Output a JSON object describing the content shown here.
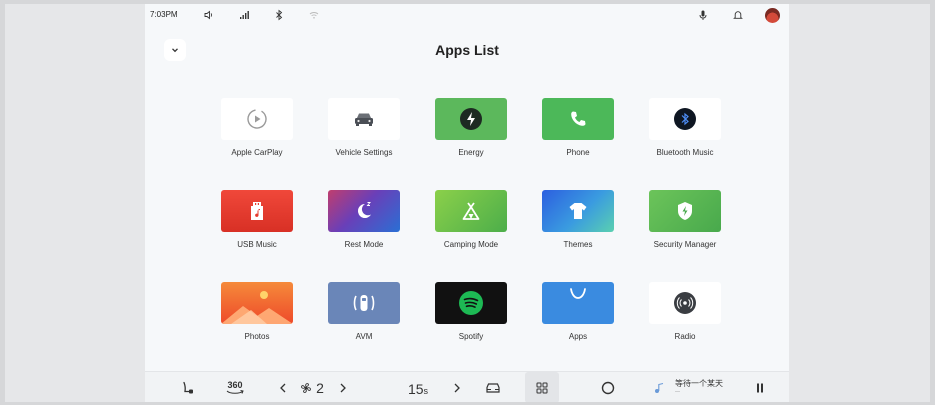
{
  "status_bar": {
    "time": "7:03PM",
    "left_icons": [
      "volume-icon",
      "signal-icon",
      "bluetooth-icon",
      "wifi-icon"
    ],
    "right_icons": [
      "microphone-icon",
      "notification-icon"
    ],
    "avatar_color": "#d34a3a"
  },
  "header": {
    "title": "Apps List",
    "collapse_icon": "chevron-down-icon"
  },
  "apps": [
    {
      "label": "Apple CarPlay",
      "icon": "carplay-icon",
      "bg": "#ffffff"
    },
    {
      "label": "Vehicle Settings",
      "icon": "car-icon",
      "bg": "#ffffff"
    },
    {
      "label": "Energy",
      "icon": "energy-icon",
      "bg": "#5cb85c"
    },
    {
      "label": "Phone",
      "icon": "phone-icon",
      "bg": "#4cb859"
    },
    {
      "label": "Bluetooth Music",
      "icon": "bluetooth-music-icon",
      "bg": "#ffffff"
    },
    {
      "label": "USB Music",
      "icon": "usb-music-icon",
      "bg": "#e63b2e"
    },
    {
      "label": "Rest Mode",
      "icon": "moon-icon",
      "bg": "#6a4ec2"
    },
    {
      "label": "Camping Mode",
      "icon": "tent-icon",
      "bg": "#6cc04a"
    },
    {
      "label": "Themes",
      "icon": "shirt-icon",
      "bg": "#3a8fd8"
    },
    {
      "label": "Security Manager",
      "icon": "shield-icon",
      "bg": "#5cb85c"
    },
    {
      "label": "Photos",
      "icon": "photos-icon",
      "bg": "#f26a2a"
    },
    {
      "label": "AVM",
      "icon": "avm-icon",
      "bg": "#6a86b8"
    },
    {
      "label": "Spotify",
      "icon": "spotify-icon",
      "bg": "#111111"
    },
    {
      "label": "Apps",
      "icon": "apps-icon",
      "bg": "#3a8be0"
    },
    {
      "label": "Radio",
      "icon": "radio-icon",
      "bg": "#ffffff"
    }
  ],
  "dock": {
    "seat_icon": "seat-icon",
    "view_360_label": "360",
    "fan_level": "2",
    "temperature": "15",
    "temperature_unit": "s",
    "media_title": "等待一个某天",
    "media_subtitle": "—"
  }
}
